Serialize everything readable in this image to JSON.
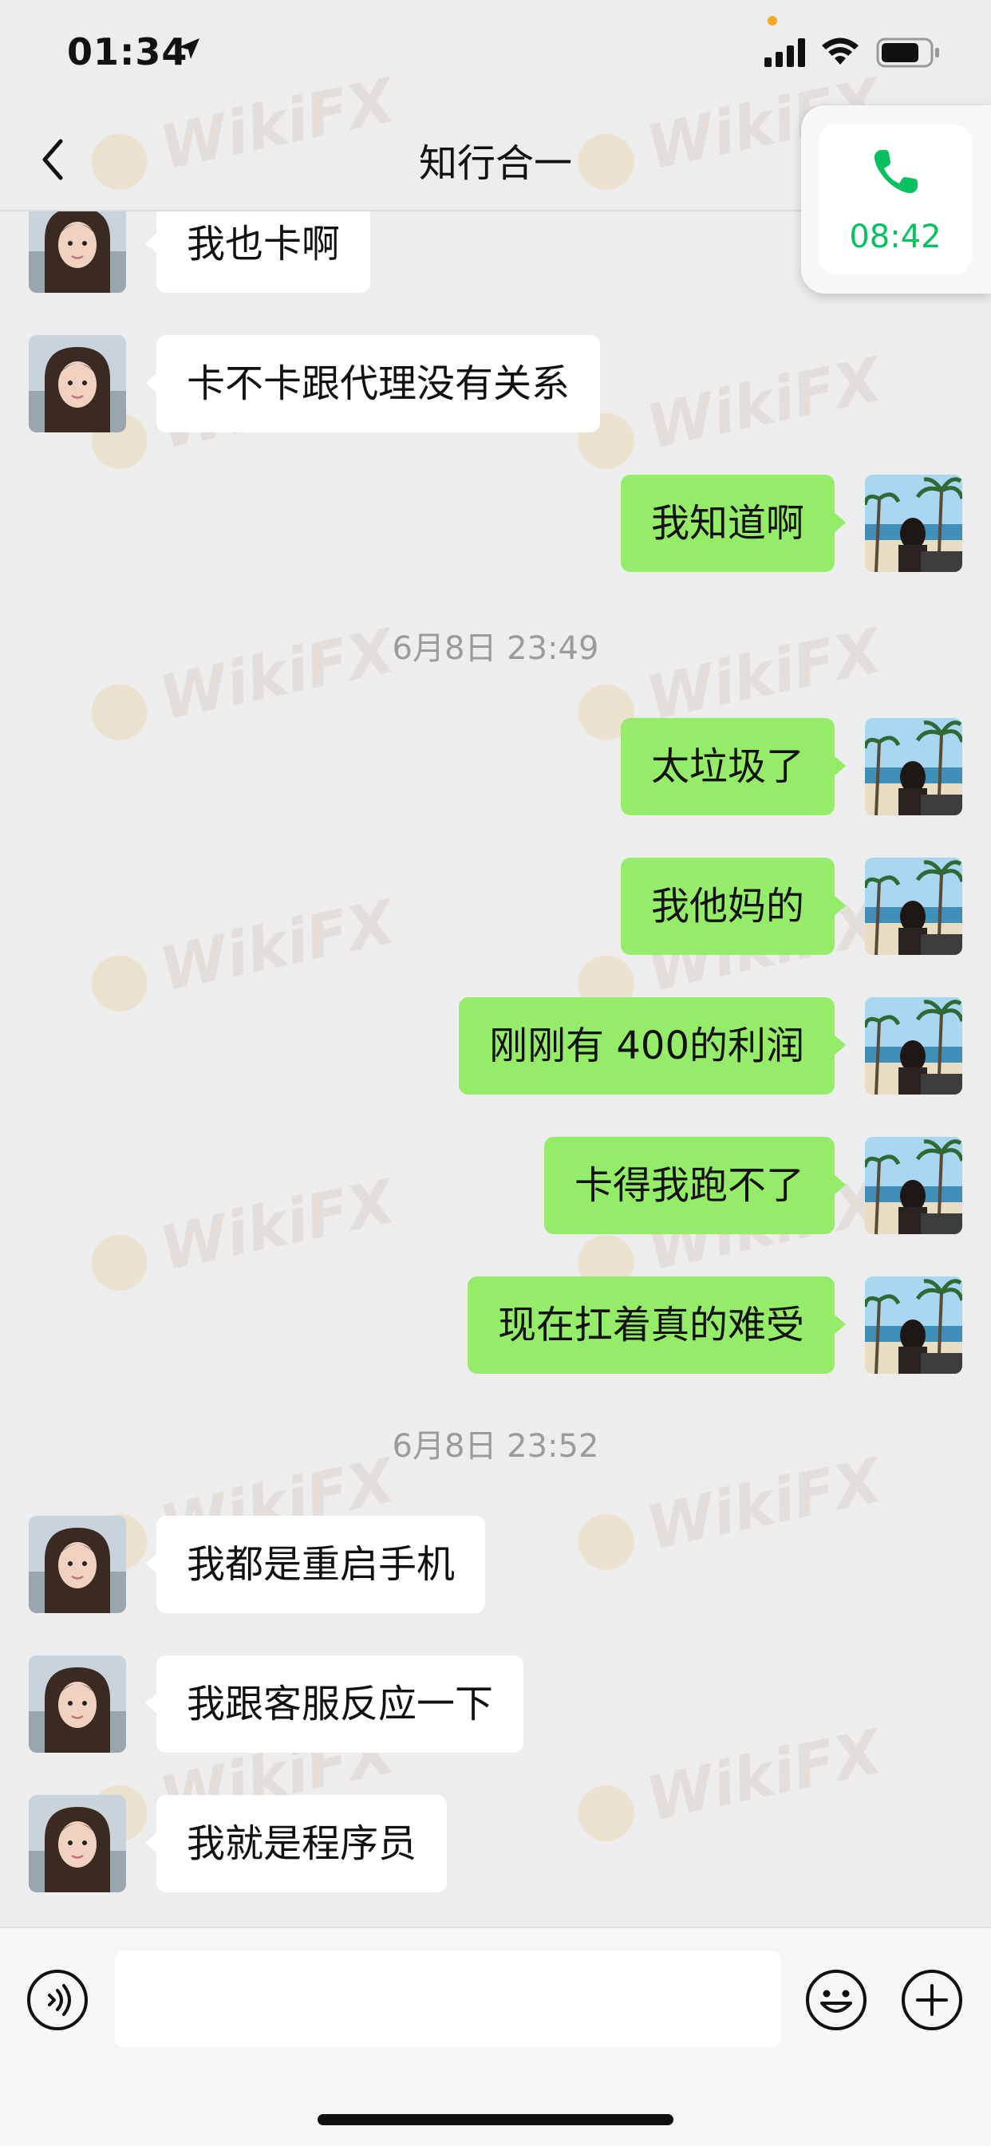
{
  "status_bar": {
    "time": "01:34"
  },
  "header": {
    "title": "知行合一"
  },
  "call": {
    "duration": "08:42"
  },
  "messages": [
    {
      "side": "in",
      "text": "我也卡啊"
    },
    {
      "side": "in",
      "text": "卡不卡跟代理没有关系"
    },
    {
      "side": "out",
      "text": "我知道啊"
    },
    {
      "side": "ts",
      "text": "6月8日 23:49"
    },
    {
      "side": "out",
      "text": "太垃圾了"
    },
    {
      "side": "out",
      "text": "我他妈的"
    },
    {
      "side": "out",
      "text": "刚刚有 400的利润"
    },
    {
      "side": "out",
      "text": "卡得我跑不了"
    },
    {
      "side": "out",
      "text": "现在扛着真的难受"
    },
    {
      "side": "ts",
      "text": "6月8日 23:52"
    },
    {
      "side": "in",
      "text": "我都是重启手机"
    },
    {
      "side": "in",
      "text": "我跟客服反应一下"
    },
    {
      "side": "in",
      "text": "我就是程序员"
    }
  ],
  "watermark": {
    "text": "WikiFX"
  },
  "input": {
    "value": ""
  },
  "colors": {
    "accent": "#07c160",
    "outgoing_bubble": "#95ec69",
    "incoming_bubble": "#ffffff",
    "background": "#ededed"
  }
}
